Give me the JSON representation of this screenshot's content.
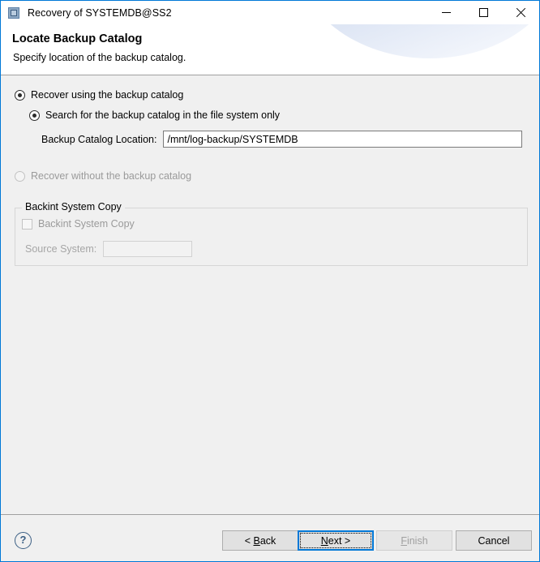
{
  "window": {
    "title": "Recovery of SYSTEMDB@SS2",
    "icon": "application-window-icon",
    "controls": {
      "minimize": "minimize-icon",
      "maximize": "maximize-icon",
      "close": "close-icon"
    },
    "border_color": "#0078d7"
  },
  "header": {
    "title": "Locate Backup Catalog",
    "subtitle": "Specify location of the backup catalog."
  },
  "main": {
    "option_with_catalog": {
      "label": "Recover using the backup catalog",
      "checked": true,
      "enabled": true
    },
    "option_search_file_system": {
      "label": "Search for the backup catalog in the file system only",
      "checked": true,
      "enabled": true
    },
    "catalog_location": {
      "label": "Backup Catalog Location:",
      "value": "/mnt/log-backup/SYSTEMDB",
      "placeholder": ""
    },
    "option_without_catalog": {
      "label": "Recover without the backup catalog",
      "checked": false,
      "enabled": false
    },
    "backint_group": {
      "title": "Backint System Copy",
      "checkbox_label": "Backint System Copy",
      "checkbox_checked": false,
      "checkbox_enabled": false,
      "source_system_label": "Source System:",
      "source_system_value": "",
      "source_system_enabled": false
    }
  },
  "footer": {
    "help": "?",
    "back": {
      "prefix": "< ",
      "mnemonic": "B",
      "suffix": "ack"
    },
    "next": {
      "prefix": "",
      "mnemonic": "N",
      "suffix": "ext >"
    },
    "finish": {
      "prefix": "",
      "mnemonic": "F",
      "suffix": "inish",
      "enabled": false
    },
    "cancel": {
      "label": "Cancel"
    }
  }
}
